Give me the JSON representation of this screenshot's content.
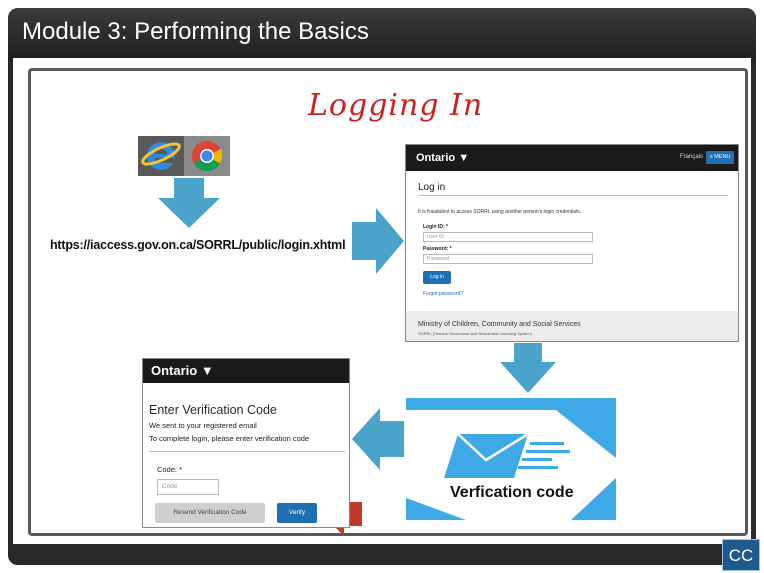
{
  "module": {
    "title": "Module 3:  Performing the Basics"
  },
  "slide": {
    "heading": "Logging In",
    "login_url": "https://iaccess.gov.on.ca/SORRL/public/login.xhtml",
    "browser_icons": [
      "internet-explorer-icon",
      "chrome-icon"
    ]
  },
  "login_screen": {
    "brand": "Ontario",
    "language_link": "Français",
    "menu_label": "≡ MENU",
    "heading": "Log in",
    "warning": "It is fraudulent to access SORRL using another person's login credentials.",
    "login_id_label": "Login ID: *",
    "login_id_placeholder": "User ID",
    "password_label": "Password: *",
    "password_placeholder": "Password",
    "login_button": "Log in",
    "forgot_link": "Forgot password?",
    "ministry": "Ministry of Children, Community and Social Services",
    "system_name": "SORRL (Serious Occurrence and Residential Licensing System)"
  },
  "verify_screen": {
    "brand": "Ontario",
    "heading": "Enter Verification Code",
    "line1": "We sent to your registered email",
    "line2": "To complete login, please enter verification code",
    "code_label": "Code: *",
    "code_placeholder": "Code",
    "resend_button": "Resend Verification Code",
    "verify_button": "Verify"
  },
  "code_graphic": {
    "caption": "Verfication code"
  },
  "player": {
    "cc_label": "CC"
  },
  "colors": {
    "heading_red": "#cc1f1f",
    "arrow_blue": "#4aa3c8",
    "arrow_red": "#c0392b",
    "ontario_blue": "#1f6fb2",
    "envelope_blue": "#3ea9e6"
  }
}
